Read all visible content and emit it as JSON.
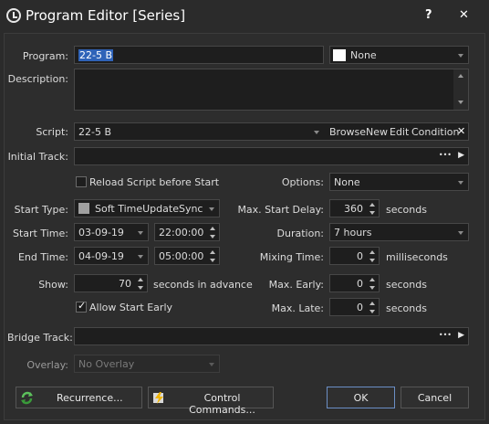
{
  "window": {
    "title": "Program Editor [Series]",
    "help": "?",
    "close": "✕"
  },
  "program": {
    "label": "Program:",
    "value": "22-5 B",
    "color_name": "None",
    "swatch_color": "#ffffff"
  },
  "description": {
    "label": "Description:",
    "value": ""
  },
  "script": {
    "label": "Script:",
    "value": "22-5 B",
    "browse": "Browse",
    "new": "New",
    "edit": "Edit",
    "condition": "Condition",
    "clear": "✕"
  },
  "initial_track": {
    "label": "Initial Track:",
    "value": "",
    "more": "•••",
    "go": "▶"
  },
  "reload": {
    "label": "Reload Script before Start",
    "checked": false
  },
  "options": {
    "label": "Options:",
    "value": "None"
  },
  "start_type": {
    "label": "Start Type:",
    "value": "Soft TimeUpdateSync"
  },
  "max_start_delay": {
    "label": "Max. Start Delay:",
    "value": "360",
    "unit": "seconds"
  },
  "start_time": {
    "label": "Start Time:",
    "date": "03-09-19",
    "time": "22:00:00"
  },
  "duration": {
    "label": "Duration:",
    "value": "7 hours"
  },
  "end_time": {
    "label": "End Time:",
    "date": "04-09-19",
    "time": "05:00:00"
  },
  "mixing_time": {
    "label": "Mixing Time:",
    "value": "0",
    "unit": "milliseconds"
  },
  "show": {
    "label": "Show:",
    "value": "70",
    "unit": "seconds in advance"
  },
  "max_early": {
    "label": "Max. Early:",
    "value": "0",
    "unit": "seconds"
  },
  "allow_start_early": {
    "label": "Allow Start Early",
    "checked": true
  },
  "max_late": {
    "label": "Max. Late:",
    "value": "0",
    "unit": "seconds"
  },
  "bridge_track": {
    "label": "Bridge Track:",
    "value": "",
    "more": "•••",
    "go": "▶"
  },
  "overlay": {
    "label": "Overlay:",
    "value": "No Overlay"
  },
  "buttons": {
    "recurrence": "Recurrence...",
    "control_commands": "Control Commands...",
    "ok": "OK",
    "cancel": "Cancel"
  },
  "colors": {
    "background": "#2b2b2b",
    "field": "#1e1e1e",
    "selection": "#2f63b8",
    "ok_border": "#6b8fc5"
  }
}
